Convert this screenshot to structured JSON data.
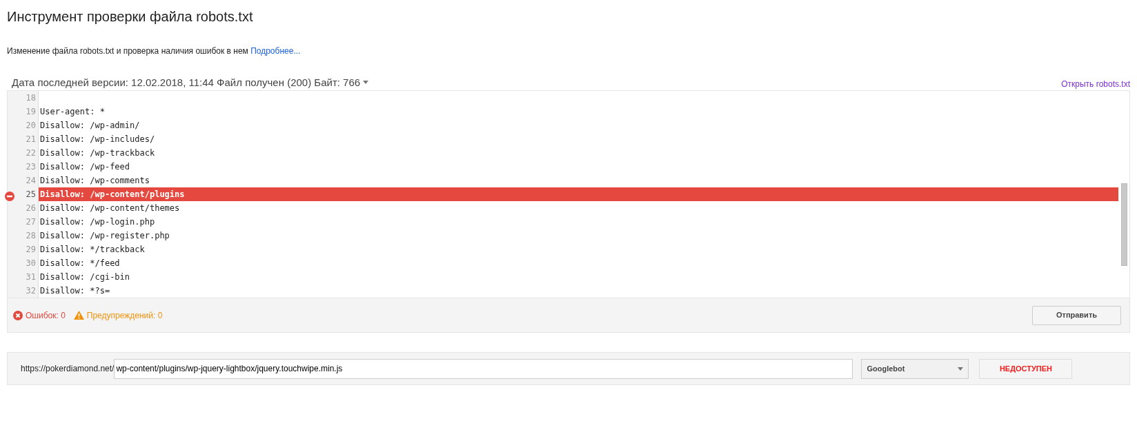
{
  "page": {
    "title": "Инструмент проверки файла robots.txt",
    "description": "Изменение файла robots.txt и проверка наличия ошибок в нем",
    "more_link": "Подробнее..."
  },
  "version_bar": {
    "label": "Дата последней версии: 12.02.2018, 11:44 Файл получен (200) Байт: 766",
    "open_link": "Открыть robots.txt"
  },
  "editor": {
    "lines": [
      {
        "number": "18",
        "error": false
      },
      {
        "number": "19",
        "text": "User-agent: *",
        "error": false
      },
      {
        "number": "20",
        "text": "Disallow: /wp-admin/",
        "error": false
      },
      {
        "number": "21",
        "text": "Disallow: /wp-includes/",
        "error": false
      },
      {
        "number": "22",
        "text": "Disallow: /wp-trackback",
        "error": false
      },
      {
        "number": "23",
        "text": "Disallow: /wp-feed",
        "error": false
      },
      {
        "number": "24",
        "text": "Disallow: /wp-comments",
        "error": false
      },
      {
        "number": "25",
        "text": "Disallow: /wp-content/plugins",
        "error": true
      },
      {
        "number": "26",
        "text": "Disallow: /wp-content/themes",
        "error": false
      },
      {
        "number": "27",
        "text": "Disallow: /wp-login.php",
        "error": false
      },
      {
        "number": "28",
        "text": "Disallow: /wp-register.php",
        "error": false
      },
      {
        "number": "29",
        "text": "Disallow: */trackback",
        "error": false
      },
      {
        "number": "30",
        "text": "Disallow: */feed",
        "error": false
      },
      {
        "number": "31",
        "text": "Disallow: /cgi-bin",
        "error": false
      },
      {
        "number": "32",
        "text": "Disallow: *?s=",
        "error": false
      }
    ]
  },
  "status": {
    "errors": "Ошибок: 0",
    "warnings": "Предупреждений: 0",
    "submit_button": "Отправить"
  },
  "test_bar": {
    "base_url": "https://pokerdiamond.net/",
    "path": "wp-content/plugins/wp-jquery-lightbox/jquery.touchwipe.min.js",
    "agent": "Googlebot",
    "result": "НЕДОСТУПЕН"
  }
}
